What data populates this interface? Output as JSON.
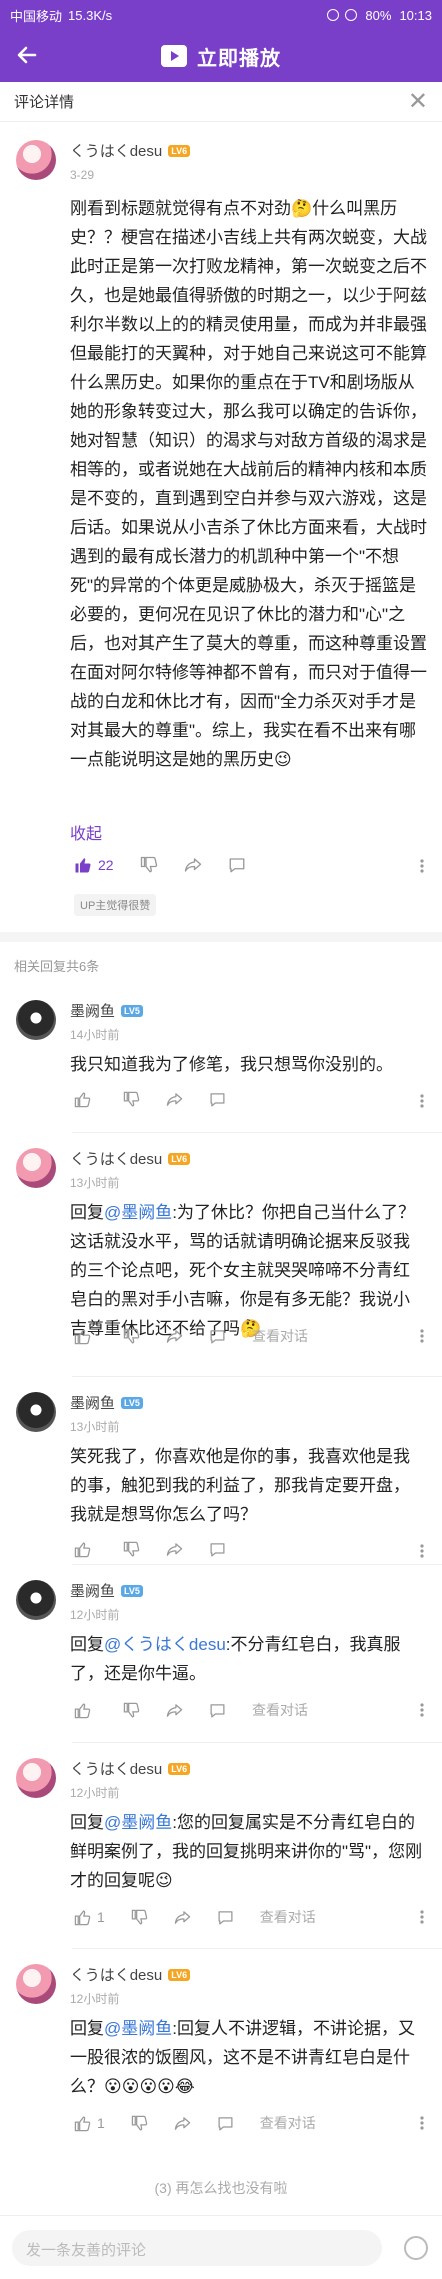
{
  "status": {
    "carrier": "中国移动",
    "speed": "15.3K/s",
    "battery": "80%",
    "time": "10:13"
  },
  "header": {
    "title": "立即播放"
  },
  "subheader": {
    "title": "评论详情"
  },
  "main_comment": {
    "user": "くうはくdesu",
    "level": "LV6",
    "date": "3-29",
    "text": "刚看到标题就觉得有点不对劲🤔什么叫黑历史？？梗宫在描述小吉线上共有两次蜕变，大战此时正是第一次打败龙精神，第一次蜕变之后不久，也是她最值得骄傲的时期之一，以少于阿兹利尔半数以上的的精灵使用量，而成为并非最强但最能打的天翼种，对于她自己来说这可不能算什么黑历史。如果你的重点在于TV和剧场版从她的形象转变过大，那么我可以确定的告诉你，她对智慧（知识）的渴求与对敌方首级的渴求是相等的，或者说她在大战前后的精神内核和本质是不变的，直到遇到空白并参与双六游戏，这是后话。如果说从小吉杀了休比方面来看，大战时遇到的最有成长潜力的机凯种中第一个\"不想死\"的异常的个体更是威胁极大，杀灭于摇篮是必要的，更何况在见识了休比的潜力和\"心\"之后，也对其产生了莫大的尊重，而这种尊重设置在面对阿尔特修等神都不曾有，而只对于值得一战的白龙和休比才有，因而\"全力杀灭对手才是对其最大的尊重\"。综上，我实在看不出来有哪一点能说明这是她的黑历史😉",
    "fold": "收起",
    "likes": "22",
    "badge": "UP主觉得很赞"
  },
  "related_label": "相关回复共6条",
  "replies": [
    {
      "user": "墨阙鱼",
      "level": "LV5",
      "time": "14小时前",
      "mention": "",
      "text": "我只知道我为了修笔，我只想骂你没别的。",
      "likes": "",
      "show_conv": false
    },
    {
      "user": "くうはくdesu",
      "level": "LV6",
      "time": "13小时前",
      "mention": "@墨阙鱼",
      "text": ":为了休比？你把自己当什么了？这话就没水平，骂的话就请明确论据来反驳我的三个论点吧，死个女主就哭哭啼啼不分青红皂白的黑对手小吉嘛，你是有多无能？我说小吉尊重休比还不给了吗🤔",
      "likes": "",
      "show_conv": true
    },
    {
      "user": "墨阙鱼",
      "level": "LV5",
      "time": "13小时前",
      "mention": "",
      "text": "笑死我了，你喜欢他是你的事，我喜欢他是我的事，触犯到我的利益了，那我肯定要开盘，我就是想骂你怎么了吗？",
      "likes": "",
      "show_conv": false
    },
    {
      "user": "墨阙鱼",
      "level": "LV5",
      "time": "12小时前",
      "mention": "@くうはくdesu",
      "text": ":不分青红皂白，我真服了，还是你牛逼。",
      "likes": "",
      "show_conv": true
    },
    {
      "user": "くうはくdesu",
      "level": "LV6",
      "time": "12小时前",
      "mention": "@墨阙鱼",
      "text": ":您的回复属实是不分青红皂白的鲜明案例了，我的回复挑明来讲你的\"骂\"，您刚才的回复呢😉",
      "likes": "1",
      "show_conv": true
    },
    {
      "user": "くうはくdesu",
      "level": "LV6",
      "time": "12小时前",
      "mention": "@墨阙鱼",
      "text": ":回复人不讲逻辑，不讲论据，又一股很浓的饭圈风，这不是不讲青红皂白是什么？😮😮😮😮😂",
      "likes": "1",
      "show_conv": true
    }
  ],
  "reply_prefix": "回复",
  "conv_label": "查看对话",
  "pager": {
    "text": "再怎么找也没有啦",
    "page": "3"
  },
  "input": {
    "placeholder": "发一条友善的评论"
  },
  "colors": {
    "accent": "#7a3fc8",
    "mention": "#3a78d8"
  },
  "icons": {
    "back": "arrow-left-icon",
    "play": "play-icon",
    "close": "close-icon",
    "like": "thumb-up-icon",
    "dislike": "thumb-down-icon",
    "share": "share-icon",
    "comment": "comment-icon",
    "emoji": "emoji-icon"
  }
}
